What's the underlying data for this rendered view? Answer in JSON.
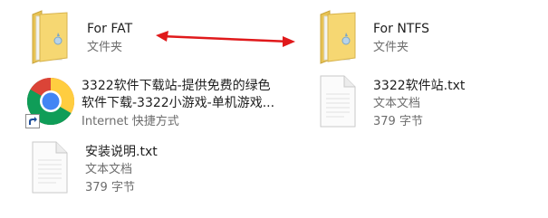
{
  "files": [
    {
      "name": "For FAT",
      "type": "文件夹",
      "icon": "folder-icon"
    },
    {
      "name": "For NTFS",
      "type": "文件夹",
      "icon": "folder-icon"
    },
    {
      "name_line1": "3322软件下载站-提供免费的绿色",
      "name_line2": "软件下载-3322小游戏-单机游戏...",
      "type": "Internet 快捷方式",
      "icon": "chrome-icon"
    },
    {
      "name": "3322软件站.txt",
      "type": "文本文档",
      "size": "379 字节",
      "icon": "text-file-icon"
    },
    {
      "name": "安装说明.txt",
      "type": "文本文档",
      "size": "379 字节",
      "icon": "text-file-icon"
    }
  ],
  "colors": {
    "arrow": "#e0191b",
    "folder": "#f3d36b",
    "label": "#1e1e1e",
    "sublabel": "#6d6d6d"
  }
}
